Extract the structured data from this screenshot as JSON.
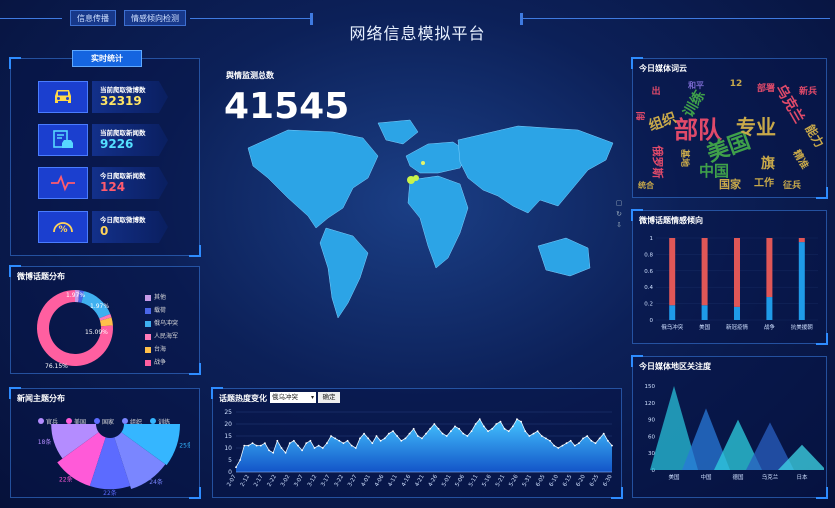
{
  "header": {
    "title": "网络信息模拟平台",
    "tabs": [
      {
        "label": "信息传播"
      },
      {
        "label": "情感倾向检测"
      }
    ]
  },
  "realtime": {
    "title_button": "实时统计",
    "stats": [
      {
        "label": "当前爬取微博数",
        "value": "32319",
        "color": "#ffe566",
        "icon": "car-icon"
      },
      {
        "label": "当前爬取新闻数",
        "value": "9226",
        "color": "#55e0ff",
        "icon": "document-car-icon"
      },
      {
        "label": "今日爬取新闻数",
        "value": "124",
        "color": "#ff5b6e",
        "icon": "pulse-icon"
      },
      {
        "label": "今日爬取微博数",
        "value": "0",
        "color": "#ffd35a",
        "icon": "gauge-icon"
      }
    ]
  },
  "monitor": {
    "label": "舆情监测总数",
    "value": "41545"
  },
  "weibo_topics": {
    "title": "微博话题分布",
    "chart_data": {
      "type": "pie",
      "categories": [
        "其他",
        "载荷",
        "俄乌冲突",
        "人民海军",
        "台海",
        "战争"
      ],
      "values": [
        1.97,
        1.97,
        15.09,
        1.5,
        3.45,
        76.15
      ],
      "colors": [
        "#c79be8",
        "#4a66e8",
        "#3fb0f0",
        "#ff7ab8",
        "#ffc04a",
        "#ff5fa0"
      ],
      "labels_shown": [
        "15.09%",
        "76.15%",
        "1.97%",
        "1.97%"
      ]
    }
  },
  "news_topics": {
    "title": "新闻主题分布",
    "chart_data": {
      "type": "pie",
      "categories": [
        "官兵",
        "美国",
        "国家",
        "组织",
        "训练"
      ],
      "values": [
        18,
        22,
        22,
        24,
        25
      ],
      "value_labels": [
        "18条",
        "22条",
        "22条",
        "24条",
        "25条"
      ],
      "colors": [
        "#b48cff",
        "#ff5ad8",
        "#5c6bff",
        "#7a86ff",
        "#35b6ff"
      ]
    }
  },
  "heat": {
    "title": "话题热度变化",
    "select_value": "俄乌冲突",
    "confirm_label": "确定",
    "chart_data": {
      "type": "area",
      "ylim": [
        0,
        25
      ],
      "y_ticks": [
        "0",
        "5",
        "10",
        "15",
        "20",
        "25"
      ],
      "x_ticks": [
        "2-07",
        "2-12",
        "2-17",
        "2-22",
        "3-02",
        "3-07",
        "3-12",
        "3-17",
        "3-22",
        "3-27",
        "4-01",
        "4-06",
        "4-11",
        "4-16",
        "4-21",
        "4-26",
        "5-01",
        "5-06",
        "5-11",
        "5-16",
        "5-21",
        "5-26",
        "5-31",
        "6-05",
        "6-10",
        "6-15",
        "6-20",
        "6-25",
        "6-30"
      ],
      "values": [
        2,
        5,
        11,
        11,
        12,
        11,
        11,
        12,
        9,
        8,
        13,
        10,
        8,
        12,
        13,
        11,
        9,
        12,
        13,
        10,
        11,
        10,
        12,
        15,
        14,
        13,
        12,
        13,
        11,
        10,
        14,
        16,
        14,
        12,
        15,
        13,
        14,
        16,
        17,
        15,
        13,
        14,
        16,
        18,
        15,
        14,
        16,
        18,
        20,
        18,
        16,
        15,
        17,
        19,
        18,
        16,
        15,
        17,
        20,
        22,
        19,
        17,
        18,
        20,
        21,
        18,
        17,
        19,
        22,
        21,
        17,
        15,
        16,
        17,
        15,
        14,
        13,
        11,
        10,
        11,
        12,
        13,
        11,
        12,
        14,
        15,
        13,
        12,
        14,
        16,
        13,
        11
      ]
    }
  },
  "wordcloud": {
    "title": "今日媒体词云",
    "words": [
      "部队",
      "美国",
      "专业",
      "组织",
      "中国",
      "训练",
      "乌克兰",
      "能力",
      "旗",
      "国家",
      "俄罗斯",
      "统合",
      "工作",
      "征兵",
      "精准",
      "部署",
      "新兵",
      "12",
      "出",
      "和平",
      "基地",
      "制"
    ]
  },
  "sentiment": {
    "title": "微博话题情感倾向",
    "chart_data": {
      "type": "bar",
      "categories": [
        "俄乌冲突",
        "美国",
        "新冠疫情",
        "战争",
        "抗美援朝"
      ],
      "series": [
        {
          "values": [
            0.82,
            0.82,
            0.84,
            0.72,
            0.05
          ],
          "color": "#e05757"
        },
        {
          "values": [
            0.18,
            0.18,
            0.16,
            0.28,
            0.95
          ],
          "color": "#1f9be8"
        }
      ],
      "ylim": [
        0,
        1
      ],
      "y_ticks": [
        "0",
        "0.2",
        "0.4",
        "0.6",
        "0.8",
        "1"
      ]
    }
  },
  "region": {
    "title": "今日媒体地区关注度",
    "chart_data": {
      "type": "area",
      "categories": [
        "美国",
        "中国",
        "德国",
        "乌克兰",
        "日本"
      ],
      "values": [
        150,
        110,
        90,
        85,
        45
      ],
      "ylim": [
        0,
        150
      ],
      "y_ticks": [
        "0",
        "30",
        "60",
        "90",
        "120",
        "150"
      ]
    }
  }
}
